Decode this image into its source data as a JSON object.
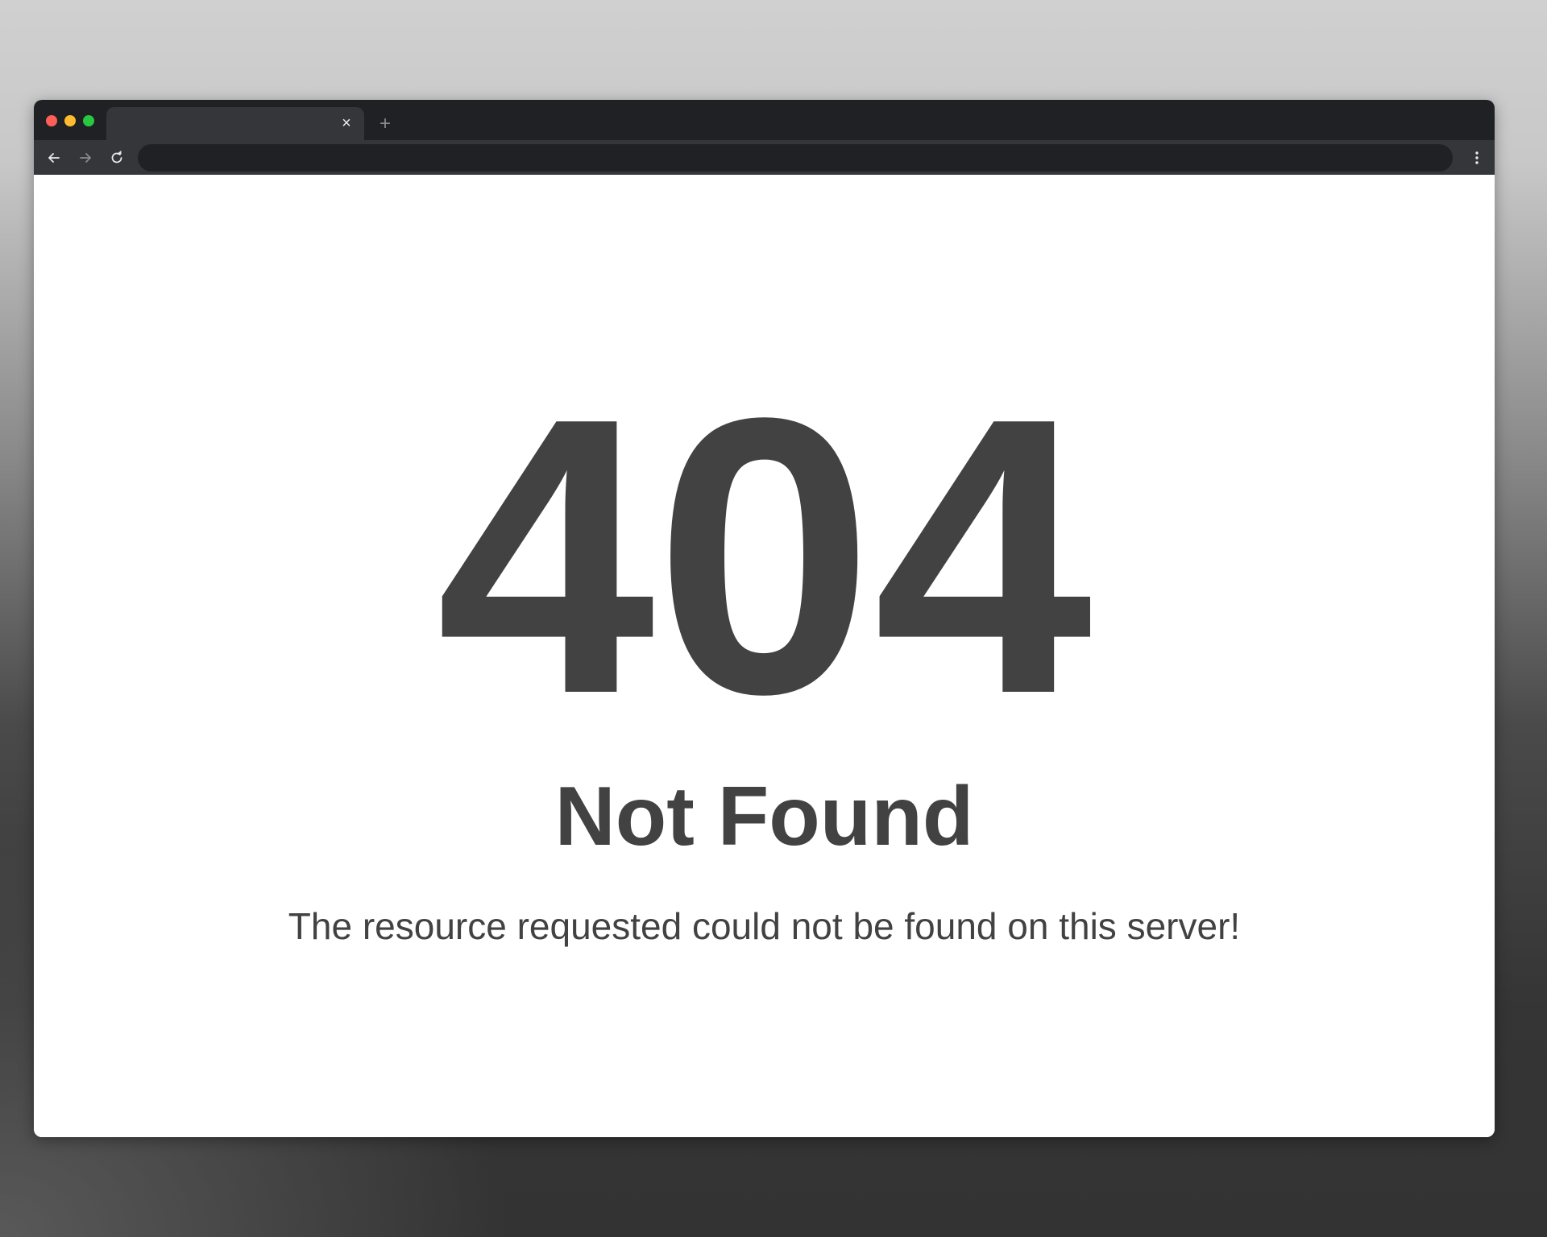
{
  "browser": {
    "tab": {
      "title": "",
      "close_glyph": "×"
    },
    "new_tab_glyph": "+",
    "address_bar": {
      "value": "",
      "placeholder": ""
    },
    "icons": {
      "close_dot": "close-window-dot",
      "minimize_dot": "minimize-window-dot",
      "maximize_dot": "maximize-window-dot",
      "back": "arrow-left-icon",
      "forward": "arrow-right-icon",
      "reload": "reload-icon",
      "menu": "more-vertical-icon"
    },
    "colors": {
      "titlebar": "#202124",
      "toolbar": "#35363a",
      "address_bar": "#202124",
      "traffic_red": "#ff5f57",
      "traffic_yellow": "#febc2e",
      "traffic_green": "#28c840"
    }
  },
  "page": {
    "code": "404",
    "title": "Not Found",
    "message": "The resource requested could not be found on this server!",
    "text_color": "#424242",
    "background": "#ffffff"
  }
}
